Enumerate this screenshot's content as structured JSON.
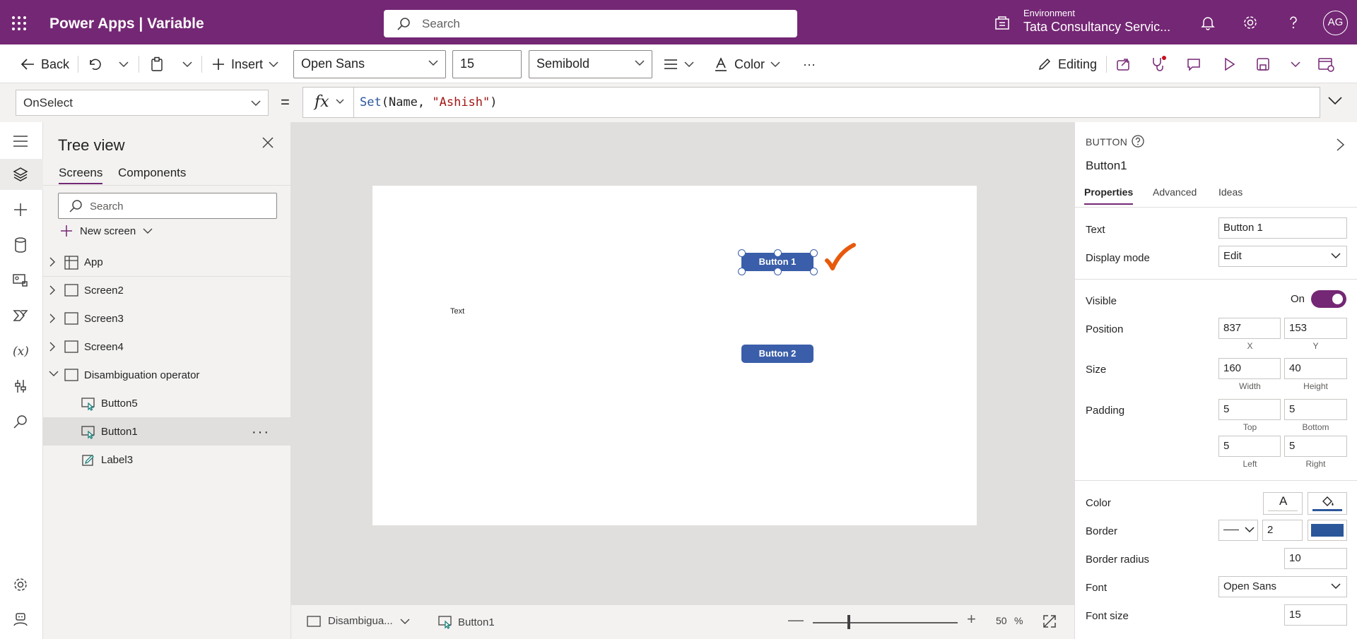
{
  "header": {
    "app_title": "Power Apps  |  Variable",
    "search_placeholder": "Search",
    "environment_label": "Environment",
    "environment_name": "Tata Consultancy Servic...",
    "avatar_initials": "AG",
    "bg_color": "#742774"
  },
  "commandbar": {
    "back_label": "Back",
    "insert_label": "Insert",
    "font_family": "Open Sans",
    "font_size": "15",
    "font_weight": "Semibold",
    "color_label": "Color",
    "more_label": "···",
    "editing_label": "Editing"
  },
  "formulabar": {
    "property": "OnSelect",
    "equals": "=",
    "fx_label": "fx",
    "formula_fn": "Set",
    "formula_args_pre": "(Name, ",
    "formula_string": "\"Ashish\"",
    "formula_close": ")"
  },
  "treeview": {
    "title": "Tree view",
    "tabs": [
      "Screens",
      "Components"
    ],
    "search_placeholder": "Search",
    "new_screen_label": "New screen",
    "items": [
      {
        "label": "App"
      },
      {
        "label": "Screen2"
      },
      {
        "label": "Screen3"
      },
      {
        "label": "Screen4"
      },
      {
        "label": "Disambiguation operator"
      },
      {
        "label": "Button5"
      },
      {
        "label": "Button1"
      },
      {
        "label": "Label3"
      }
    ],
    "more_label": "···"
  },
  "canvas": {
    "button1_label": "Button 1",
    "button2_label": "Button 2",
    "text_label": "Text",
    "button_color": "#3a5ea9",
    "annotation_color": "#e8590c"
  },
  "statusbar": {
    "screen_crumb": "Disambigua...",
    "control_crumb": "Button1",
    "zoom_minus": "—",
    "zoom_plus": "+",
    "zoom_value": "50",
    "zoom_unit": "%",
    "zoom_level": 0.25
  },
  "properties": {
    "control_type": "BUTTON",
    "control_name": "Button1",
    "tabs": [
      "Properties",
      "Advanced",
      "Ideas"
    ],
    "text_label": "Text",
    "text_value": "Button 1",
    "display_mode_label": "Display mode",
    "display_mode_value": "Edit",
    "visible_label": "Visible",
    "visible_state": "On",
    "position_label": "Position",
    "position_x": "837",
    "position_y": "153",
    "x_label": "X",
    "y_label": "Y",
    "size_label": "Size",
    "size_width": "160",
    "size_height": "40",
    "width_label": "Width",
    "height_label": "Height",
    "padding_label": "Padding",
    "padding_top": "5",
    "padding_bottom": "5",
    "padding_left": "5",
    "padding_right": "5",
    "top_label": "Top",
    "bottom_label": "Bottom",
    "left_label": "Left",
    "right_label": "Right",
    "color_label": "Color",
    "color_text_glyph": "A",
    "border_label": "Border",
    "border_width": "2",
    "border_color": "#2b579a",
    "border_radius_label": "Border radius",
    "border_radius_value": "10",
    "font_label": "Font",
    "font_value": "Open Sans",
    "font_size_label": "Font size",
    "font_size_value": "15"
  }
}
